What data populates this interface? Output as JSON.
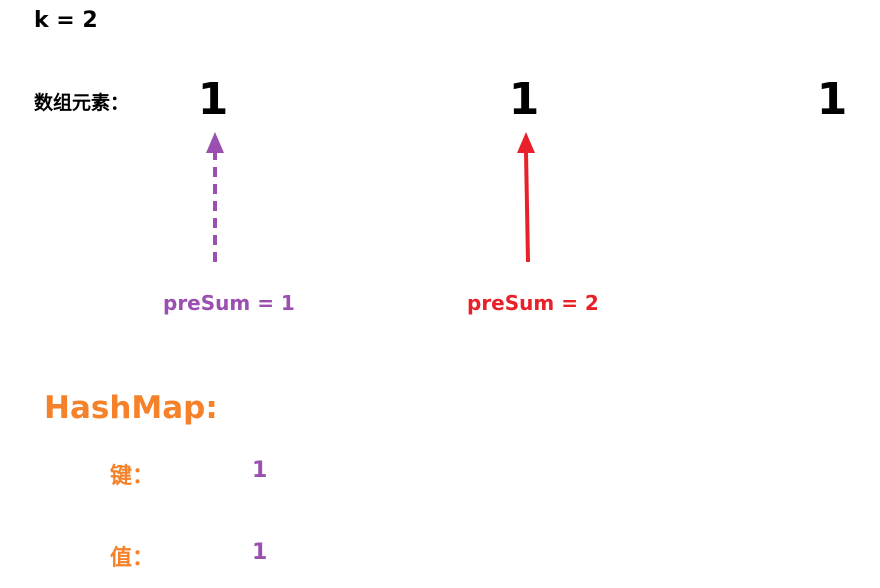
{
  "header": {
    "k_text": "k = 2"
  },
  "array": {
    "label": "数组元素：",
    "elements": [
      "1",
      "1",
      "1"
    ]
  },
  "pointers": {
    "previous": {
      "text": "preSum = 1",
      "color": "#9b4fb0",
      "style": "dashed"
    },
    "current": {
      "text": "preSum = 2",
      "color": "#e8202a",
      "style": "solid"
    }
  },
  "hashmap": {
    "title": "HashMap:",
    "title_color": "#f5822a",
    "label_color": "#f5822a",
    "value_color": "#9b4fb0",
    "key_label": "键：",
    "key_value": "1",
    "value_label": "值：",
    "value_value": "1"
  }
}
